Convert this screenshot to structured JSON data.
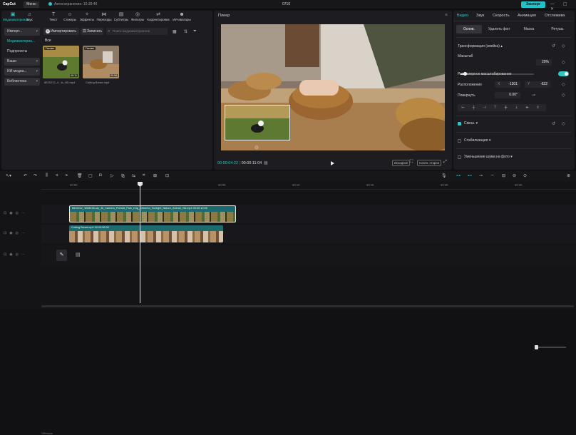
{
  "app": {
    "logo": "CapCut",
    "menu_label": "Меню",
    "autosave": "Автосохранение: 10:39:46",
    "project_name": "0710",
    "export_label": "Экспорт",
    "window_controls": "—  ▢  ✕"
  },
  "media_panel": {
    "tabs": [
      {
        "label": "Медиаматериалы",
        "icon": "▣"
      },
      {
        "label": "Звук",
        "icon": "♫"
      },
      {
        "label": "Текст",
        "icon": "T"
      },
      {
        "label": "Стикеры",
        "icon": "☺"
      },
      {
        "label": "Эффекты",
        "icon": "✧"
      },
      {
        "label": "Переходы",
        "icon": "⋈"
      },
      {
        "label": "Субтитры",
        "icon": "▤"
      },
      {
        "label": "Фильтры",
        "icon": "◎"
      },
      {
        "label": "Корректировка",
        "icon": "⇄"
      },
      {
        "label": "ИИ-аватары",
        "icon": "☻"
      }
    ],
    "sidebar": [
      {
        "label": "Импорт...",
        "chev": "▾"
      },
      {
        "label": "Медиаматериа...",
        "chev": ""
      },
      {
        "label": "Подпроекты",
        "chev": ""
      },
      {
        "label": "Ваши",
        "chev": "▾"
      },
      {
        "label": "ИИ-медиа...",
        "chev": "▾"
      },
      {
        "label": "Библиотека",
        "chev": "▾"
      }
    ],
    "import_button": "Импортировать",
    "record_button": "Записать",
    "search_placeholder": "Поиск медиаматериалов",
    "filter_all": "Все",
    "items": [
      {
        "tag": "Готово",
        "duration": "00:11",
        "name": "8515212_4...st_HD.mp4"
      },
      {
        "tag": "Готово",
        "duration": "00:08",
        "name": "Cutting Bread.mp4"
      }
    ]
  },
  "player": {
    "title": "Плеер",
    "current_time": "00:00:04:22",
    "total_time": "00:00:11:04",
    "btn_original": "Исходное",
    "btn_ratio": "Соотн. сторон"
  },
  "inspector": {
    "tabs": [
      "Видео",
      "Звук",
      "Скорость",
      "Анимация",
      "Отслежива"
    ],
    "subtabs": [
      "Основ.",
      "Удалить фон",
      "Маска",
      "Ретушь"
    ],
    "transform_label": "Трансформация (змейка)",
    "scale_label": "Масштаб",
    "scale_value": "29%",
    "scale_percent": 29,
    "uniform_label": "Равномерное масштабирование",
    "position_label": "Расположение",
    "pos_x_label": "X",
    "pos_x": "-1301",
    "pos_y_label": "Y",
    "pos_y": "-622",
    "rotate_label": "Повернуть",
    "rotate_value": "0.00°",
    "blend_label": "Смеш.",
    "stabilize_label": "Стабилизация",
    "denoise_label": "Уменьшение шума на фото"
  },
  "timeline": {
    "ticks": [
      "00:00",
      "00:05",
      "00:10",
      "00:15",
      "00:20",
      "00:25"
    ],
    "clip1": {
      "label": "8515212_4068435-ulp_4k_Camera_Portrait_Park_Dog_Cheerful_Sunlight_Nature_Animal_HD.mp4",
      "dur": "00:00:10:08"
    },
    "clip2": {
      "label": "Cutting Bread.mp4",
      "dur": "00:00:08:00"
    },
    "covers_label": "Обложка"
  }
}
